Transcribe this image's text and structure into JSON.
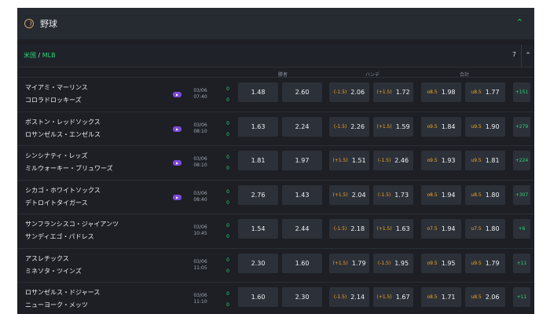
{
  "sport": {
    "title": "野球"
  },
  "league": {
    "name_country": "米国",
    "name_sep": " / ",
    "name_league": "MLB",
    "count": "7"
  },
  "columns": {
    "win": "勝者",
    "handicap": "ハンデ",
    "total": "合計"
  },
  "matches": [
    {
      "home": "マイアミ・マーリンス",
      "away": "コロラドロッキーズ",
      "live": true,
      "date": "03/06",
      "time": "07:40",
      "score1": "0",
      "score2": "0",
      "ml1": "1.48",
      "ml2": "2.60",
      "hc1_line": "(-1.5)",
      "hc1": "2.06",
      "hc2_line": "(+1.5)",
      "hc2": "1.72",
      "ou1_line": "o8.5",
      "ou1": "1.98",
      "ou2_line": "u8.5",
      "ou2": "1.77",
      "more": "+151"
    },
    {
      "home": "ボストン・レッドソックス",
      "away": "ロサンゼルス・エンゼルス",
      "live": true,
      "date": "03/06",
      "time": "08:10",
      "score1": "0",
      "score2": "0",
      "ml1": "1.63",
      "ml2": "2.24",
      "hc1_line": "(-1.5)",
      "hc1": "2.26",
      "hc2_line": "(+1.5)",
      "hc2": "1.59",
      "ou1_line": "o9.5",
      "ou1": "1.84",
      "ou2_line": "u9.5",
      "ou2": "1.90",
      "more": "+279"
    },
    {
      "home": "シンシナティ・レッズ",
      "away": "ミルウォーキー・ブリュワーズ",
      "live": true,
      "date": "03/06",
      "time": "08:10",
      "score1": "0",
      "score2": "0",
      "ml1": "1.81",
      "ml2": "1.97",
      "hc1_line": "(+1.5)",
      "hc1": "1.51",
      "hc2_line": "(-1.5)",
      "hc2": "2.46",
      "ou1_line": "o9.5",
      "ou1": "1.93",
      "ou2_line": "u9.5",
      "ou2": "1.81",
      "more": "+224"
    },
    {
      "home": "シカゴ・ホワイトソックス",
      "away": "デトロイトタイガース",
      "live": true,
      "date": "03/06",
      "time": "08:40",
      "score1": "0",
      "score2": "0",
      "ml1": "2.76",
      "ml2": "1.43",
      "hc1_line": "(+1.5)",
      "hc1": "2.04",
      "hc2_line": "(-1.5)",
      "hc2": "1.73",
      "ou1_line": "o8.5",
      "ou1": "1.94",
      "ou2_line": "u8.5",
      "ou2": "1.80",
      "more": "+307"
    },
    {
      "home": "サンフランシスコ・ジャイアンツ",
      "away": "サンディエゴ・パドレス",
      "live": false,
      "date": "03/06",
      "time": "10:45",
      "score1": "0",
      "score2": "0",
      "ml1": "1.54",
      "ml2": "2.44",
      "hc1_line": "(-1.5)",
      "hc1": "2.18",
      "hc2_line": "(+1.5)",
      "hc2": "1.63",
      "ou1_line": "o7.5",
      "ou1": "1.94",
      "ou2_line": "u7.5",
      "ou2": "1.80",
      "more": "+6"
    },
    {
      "home": "アスレチックス",
      "away": "ミネソタ・ツインズ",
      "live": false,
      "date": "03/06",
      "time": "11:05",
      "score1": "0",
      "score2": "0",
      "ml1": "2.30",
      "ml2": "1.60",
      "hc1_line": "(+1.5)",
      "hc1": "1.79",
      "hc2_line": "(-1.5)",
      "hc2": "1.95",
      "ou1_line": "o9.5",
      "ou1": "1.95",
      "ou2_line": "u9.5",
      "ou2": "1.79",
      "more": "+11"
    },
    {
      "home": "ロサンゼルス・ドジャース",
      "away": "ニューヨーク・メッツ",
      "live": false,
      "date": "03/06",
      "time": "11:10",
      "score1": "0",
      "score2": "0",
      "ml1": "1.60",
      "ml2": "2.30",
      "hc1_line": "(-1.5)",
      "hc1": "2.14",
      "hc2_line": "(+1.5)",
      "hc2": "1.67",
      "ou1_line": "o8.5",
      "ou1": "1.71",
      "ou2_line": "u8.5",
      "ou2": "2.06",
      "more": "+11"
    }
  ]
}
